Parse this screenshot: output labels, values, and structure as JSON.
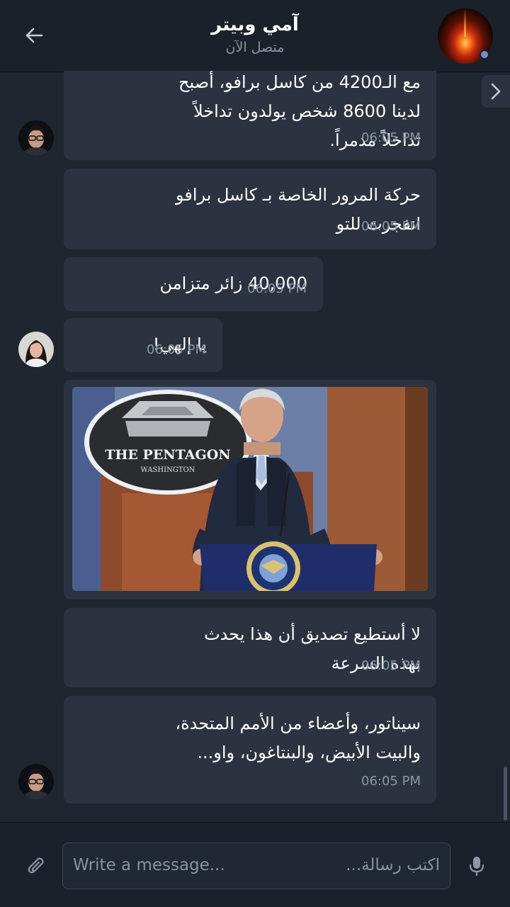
{
  "header": {
    "title": "آمي وبيتر",
    "subtitle": "متصل الآن",
    "back_icon": "arrow-left-icon",
    "avatar_icon": "glowing-planet-avatar",
    "online_color": "#7c8bc9"
  },
  "messages": [
    {
      "lines": [
        "مع الـ4200 من كاسل برافو، أصبح",
        "لدينا 8600 شخص يولدون تداخلاً",
        "تداخلاً مدمراً."
      ],
      "time": "06:05 PM"
    },
    {
      "lines": [
        "حركة المرور الخاصة بـ كاسل برافو",
        "انفجرت للتو"
      ],
      "time": "06:05 PM"
    },
    {
      "lines": [
        "40,000 زائر متزامن"
      ],
      "time": "06:05 PM"
    },
    {
      "lines": [
        "يا إلهي!"
      ],
      "time": "06:05 PM"
    },
    {
      "lines": [
        "لا أستطيع تصديق أن هذا يحدث",
        "بهذه السرعة"
      ],
      "time": "06:05 PM"
    },
    {
      "lines": [
        "سيناتور، وأعضاء من الأمم المتحدة،",
        "والبيت الأبيض، والبنتاغون، واو..."
      ],
      "time": "06:05 PM"
    }
  ],
  "photo": {
    "sign_title": "THE PENTAGON",
    "sign_sub": "WASHINGTON",
    "seal_text": "DEPARTMENT OF DEFENSE"
  },
  "composer": {
    "placeholder_en": "Write a message...",
    "placeholder_ar": "اكتب رسالة...",
    "attach_icon": "paperclip-icon",
    "mic_icon": "microphone-icon"
  },
  "colors": {
    "background": "#1f2630",
    "bubble": "#2b3340",
    "header": "#1a212a",
    "time": "#8c97a6"
  }
}
